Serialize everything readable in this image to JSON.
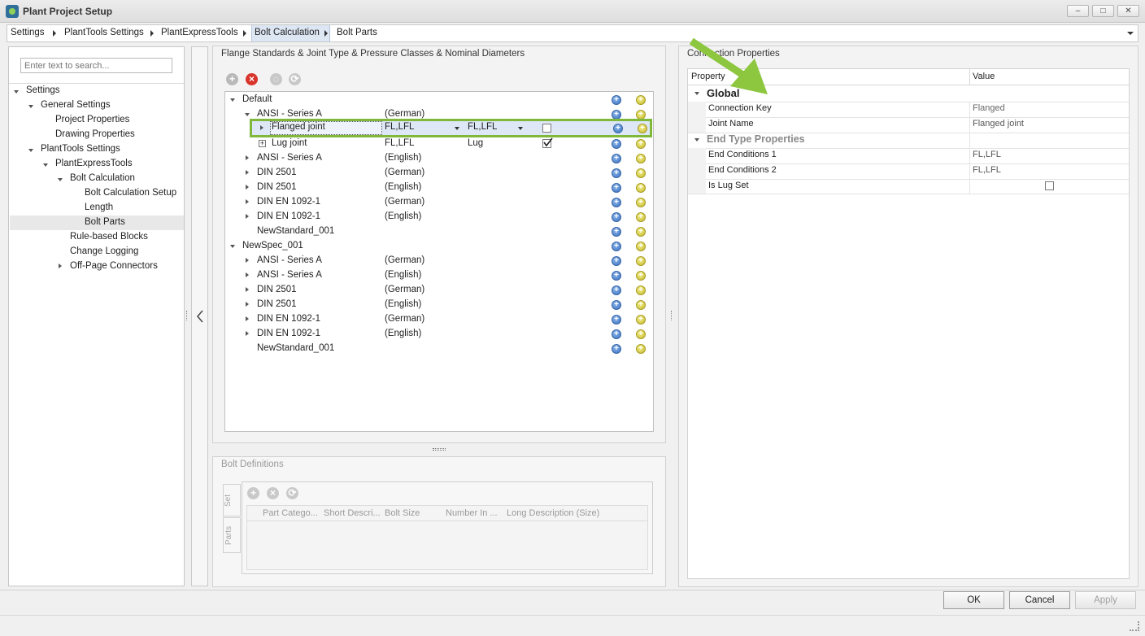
{
  "window": {
    "title": "Plant Project Setup",
    "minimize": "–",
    "maximize": "□",
    "close": "✕"
  },
  "breadcrumb": {
    "items": [
      "Settings",
      "PlantTools Settings",
      "PlantExpressTools",
      "Bolt Calculation",
      "Bolt Parts"
    ]
  },
  "sidebar": {
    "search_placeholder": "Enter text to search...",
    "items": [
      "Settings",
      "General Settings",
      "Project Properties",
      "Drawing Properties",
      "PlantTools Settings",
      "PlantExpressTools",
      "Bolt Calculation",
      "Bolt Calculation Setup",
      "Length",
      "Bolt Parts",
      "Rule-based Blocks",
      "Change Logging",
      "Off-Page Connectors"
    ]
  },
  "flange_panel": {
    "title": "Flange Standards & Joint Type & Pressure Classes & Nominal Diameters",
    "rows": [
      {
        "name": "Default",
        "lang": ""
      },
      {
        "name": "ANSI - Series A",
        "lang": "(German)"
      },
      {
        "name": "Flanged joint",
        "c1": "FL,LFL",
        "c2": "FL,LFL"
      },
      {
        "name": "Lug joint",
        "c1": "FL,LFL",
        "c2": "Lug"
      },
      {
        "name": "ANSI - Series A",
        "lang": "(English)"
      },
      {
        "name": "DIN 2501",
        "lang": "(German)"
      },
      {
        "name": "DIN 2501",
        "lang": "(English)"
      },
      {
        "name": "DIN EN 1092-1",
        "lang": "(German)"
      },
      {
        "name": "DIN EN 1092-1",
        "lang": "(English)"
      },
      {
        "name": "NewStandard_001",
        "lang": ""
      },
      {
        "name": "NewSpec_001",
        "lang": ""
      },
      {
        "name": "ANSI - Series A",
        "lang": "(German)"
      },
      {
        "name": "ANSI - Series A",
        "lang": "(English)"
      },
      {
        "name": "DIN 2501",
        "lang": "(German)"
      },
      {
        "name": "DIN 2501",
        "lang": "(English)"
      },
      {
        "name": "DIN EN 1092-1",
        "lang": "(German)"
      },
      {
        "name": "DIN EN 1092-1",
        "lang": "(English)"
      },
      {
        "name": "NewStandard_001",
        "lang": ""
      }
    ]
  },
  "bolt_panel": {
    "title": "Bolt Definitions",
    "tabs": [
      "Set",
      "Parts"
    ],
    "columns": [
      "Part Catego...",
      "Short Descri...",
      "Bolt Size",
      "Number In ...",
      "Long Description (Size)"
    ]
  },
  "connection_panel": {
    "title": "Connection Properties",
    "col_property": "Property",
    "col_value": "Value",
    "category_global": "Global",
    "category_end": "End Type Properties",
    "props": [
      {
        "name": "Connection Key",
        "value": "Flanged"
      },
      {
        "name": "Joint Name",
        "value": "Flanged joint"
      },
      {
        "name": "End Conditions 1",
        "value": "FL,LFL"
      },
      {
        "name": "End Conditions 2",
        "value": "FL,LFL"
      },
      {
        "name": "Is Lug Set",
        "value": ""
      }
    ]
  },
  "footer": {
    "ok": "OK",
    "cancel": "Cancel",
    "apply": "Apply"
  },
  "colors": {
    "highlight": "#7fb83a",
    "arrow": "#8dc63f",
    "selection": "#dde7f5"
  }
}
